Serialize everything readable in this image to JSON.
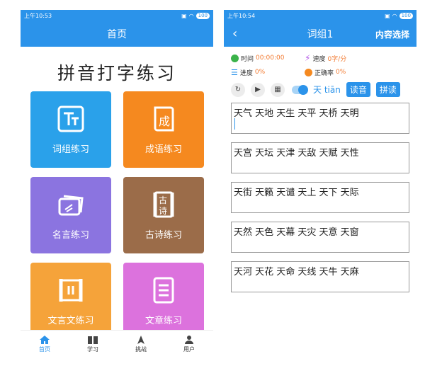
{
  "left": {
    "status": {
      "time": "上午10:53",
      "battery": "100"
    },
    "nav_title": "首页",
    "heading": "拼音打字练习",
    "tiles": [
      {
        "label": "词组练习",
        "icon": "letters-tt-icon",
        "color": "#2aa1ea"
      },
      {
        "label": "成语练习",
        "icon": "idiom-book-icon",
        "color": "#f5891f"
      },
      {
        "label": "名言练习",
        "icon": "cards-icon",
        "color": "#8b74e0"
      },
      {
        "label": "古诗练习",
        "icon": "poem-scroll-icon",
        "color": "#9b6c49"
      },
      {
        "label": "文言文练习",
        "icon": "scroll-icon",
        "color": "#f5a33a"
      },
      {
        "label": "文章练习",
        "icon": "article-icon",
        "color": "#dc72dd"
      }
    ],
    "tabs": [
      {
        "label": "首页",
        "icon": "home-icon"
      },
      {
        "label": "学习",
        "icon": "book-icon"
      },
      {
        "label": "挑战",
        "icon": "challenge-icon"
      },
      {
        "label": "用户",
        "icon": "user-icon"
      }
    ]
  },
  "right": {
    "status": {
      "time": "上午10:54",
      "battery": "100"
    },
    "nav_title": "词组1",
    "nav_action": "内容选择",
    "stats": {
      "time_label": "时间",
      "time_value": "00:00:00",
      "speed_label": "速度",
      "speed_value": "0字/分",
      "progress_label": "进度",
      "progress_value": "0%",
      "accuracy_label": "正确率",
      "accuracy_value": "0%"
    },
    "toolbar": {
      "pinyin_char": "天",
      "pinyin_text": "tiān",
      "read_label": "读音",
      "spell_label": "拼读"
    },
    "groups": [
      "天气 天地 天生 天平 天桥 天明",
      "天宫 天坛 天津 天敌 天赋 天性",
      "天街 天籁 天谴 天上 天下 天际",
      "天然 天色 天幕 天灾 天意 天窗",
      "天河 天花 天命 天线 天牛 天麻"
    ]
  },
  "colors": {
    "primary": "#2b93ea",
    "accent": "#f27a30"
  }
}
